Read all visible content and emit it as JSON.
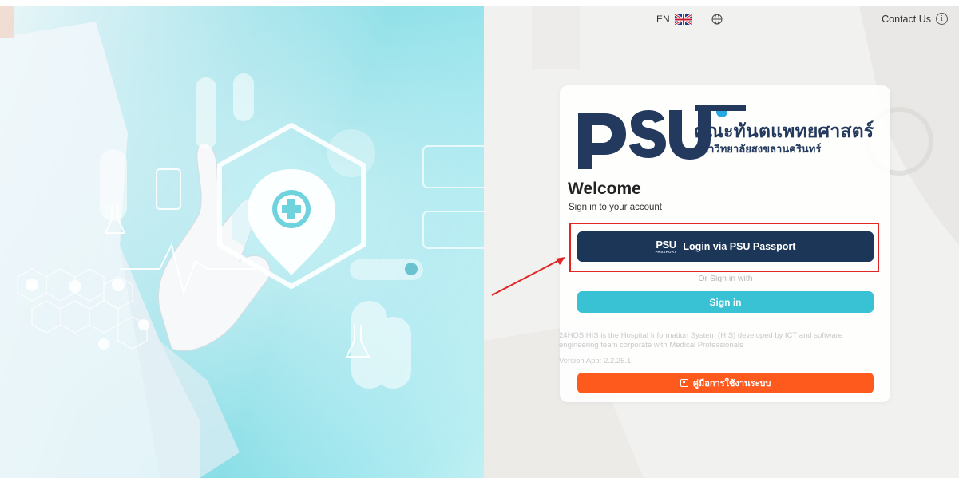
{
  "topbar": {
    "language": "EN",
    "contact_label": "Contact Us",
    "icons": [
      "uk-flag-icon",
      "globe-icon",
      "info-icon"
    ]
  },
  "logo": {
    "mark": "PSU",
    "title": "คณะทันตแพทยศาสตร์",
    "subtitle": "มหาวิทยาลัยสงขลานครินทร์"
  },
  "welcome": {
    "title": "Welcome",
    "subtitle": "Sign in to your account"
  },
  "buttons": {
    "psu_mark": "PSU",
    "psu_mark_sub": "PASSPORT",
    "psu_login": "Login via PSU Passport",
    "or_text": "Or Sign in with",
    "sign_in": "Sign in",
    "manual": "คู่มือการใช้งานระบบ"
  },
  "info": {
    "description": "24HOS HIS is the Hospital Information System (HIS) developed by ICT and software engineering team corporate with Medical Professionals",
    "version": "Version App: 2.2.25.1"
  },
  "colors": {
    "navy": "#1c3658",
    "cyan": "#39c1d4",
    "orange": "#ff5a1e",
    "highlight_red": "#e42525"
  }
}
